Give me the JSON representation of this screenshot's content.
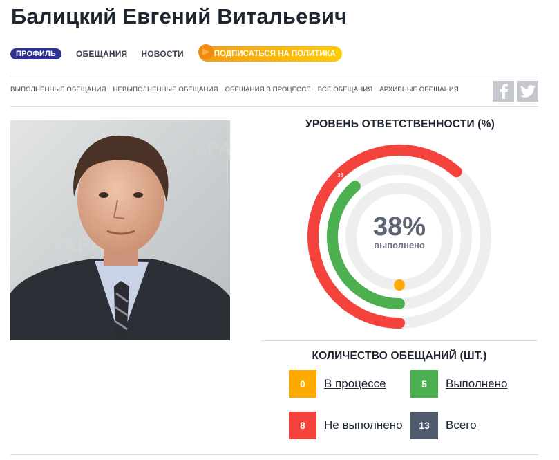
{
  "page": {
    "title": "Балицкий Евгений Витальевич"
  },
  "nav": {
    "profile": "ПРОФИЛЬ",
    "promises": "ОБЕЩАНИЯ",
    "news": "НОВОСТИ",
    "subscribe": "ПОДПИСАТЬСЯ НА ПОЛИТИКА"
  },
  "subnav": [
    "ВЫПОЛНЕННЫЕ ОБЕЩАНИЯ",
    "НЕВЫПОЛНЕННЫЕ ОБЕЩАНИЯ",
    "ОБЕЩАНИЯ В ПРОЦЕССЕ",
    "ВСЕ ОБЕЩАНИЯ",
    "АРХИВНЫЕ ОБЕЩАНИЯ"
  ],
  "social": {
    "facebook_icon": "f",
    "twitter_icon": "bird"
  },
  "responsibility": {
    "title": "УРОВЕНЬ ОТВЕТСТВЕННОСТИ (%)",
    "percent_label": "38%",
    "caption": "выполнено",
    "small_label": "38",
    "rings": [
      {
        "name": "not-fulfilled",
        "fraction": 0.615,
        "color": "#f4433c"
      },
      {
        "name": "fulfilled",
        "fraction": 0.385,
        "color": "#4caf50"
      },
      {
        "name": "in-progress",
        "fraction": 0.0,
        "color": "#ffaa00"
      }
    ],
    "track_color": "#eeeeee"
  },
  "counts": {
    "title": "КОЛИЧЕСТВО ОБЕЩАНИЙ (ШТ.)",
    "items": [
      {
        "value": "0",
        "label": "В процессе",
        "color": "#ffaa00"
      },
      {
        "value": "5",
        "label": "Выполнено",
        "color": "#4caf50"
      },
      {
        "value": "8",
        "label": "Не выполнено",
        "color": "#f4433c"
      },
      {
        "value": "13",
        "label": "Всего",
        "color": "#4f5b6c"
      }
    ]
  }
}
